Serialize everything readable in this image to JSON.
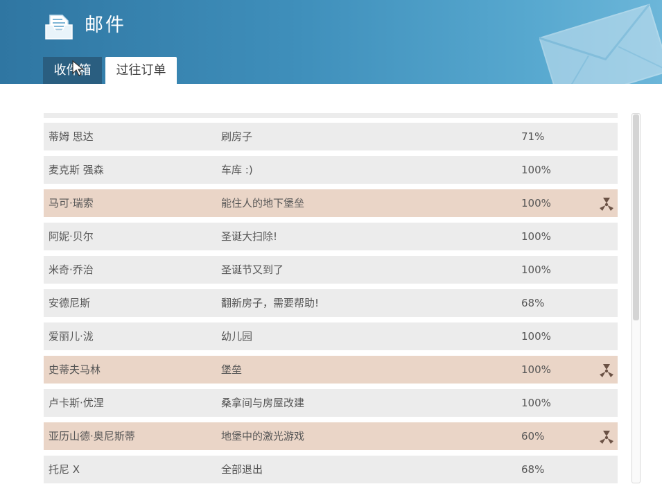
{
  "header": {
    "title": "邮件",
    "tabs": [
      {
        "label": "收件箱",
        "active": true
      },
      {
        "label": "过往订单",
        "active": false
      }
    ]
  },
  "icons": {
    "mail": "mail-tray-icon",
    "decoration": "envelope-icon",
    "row_marker": "radiation-icon",
    "pointer": "mouse-cursor-icon"
  },
  "colors": {
    "header_start": "#2f76a2",
    "header_end": "#6cb6d9",
    "active_tab": "#2a5e80",
    "row": "#ececec",
    "row_special": "#ead5c7",
    "marker": "#6b5245"
  },
  "orders": [
    {
      "name": "蒂姆 思达",
      "job": "刷房子",
      "progress": "71%",
      "special": false
    },
    {
      "name": "麦克斯 强森",
      "job": "车库 :)",
      "progress": "100%",
      "special": false
    },
    {
      "name": "马可·瑞索",
      "job": "能住人的地下堡垒",
      "progress": "100%",
      "special": true
    },
    {
      "name": "阿妮·贝尔",
      "job": "圣诞大扫除!",
      "progress": "100%",
      "special": false
    },
    {
      "name": "米奇·乔治",
      "job": "圣诞节又到了",
      "progress": "100%",
      "special": false
    },
    {
      "name": "安德尼斯",
      "job": "翻新房子，需要帮助!",
      "progress": "68%",
      "special": false
    },
    {
      "name": "爱丽儿·泷",
      "job": "幼儿园",
      "progress": "100%",
      "special": false
    },
    {
      "name": "史蒂夫马林",
      "job": "堡垒",
      "progress": "100%",
      "special": true
    },
    {
      "name": "卢卡斯·优涅",
      "job": "桑拿间与房屋改建",
      "progress": "100%",
      "special": false
    },
    {
      "name": "亚历山德·奥尼斯蒂",
      "job": "地堡中的激光游戏",
      "progress": "60%",
      "special": true
    },
    {
      "name": "托尼 X",
      "job": "全部退出",
      "progress": "68%",
      "special": false
    }
  ],
  "scrollbar": {
    "position_fraction": 0.0,
    "visible_fraction": 0.55
  }
}
